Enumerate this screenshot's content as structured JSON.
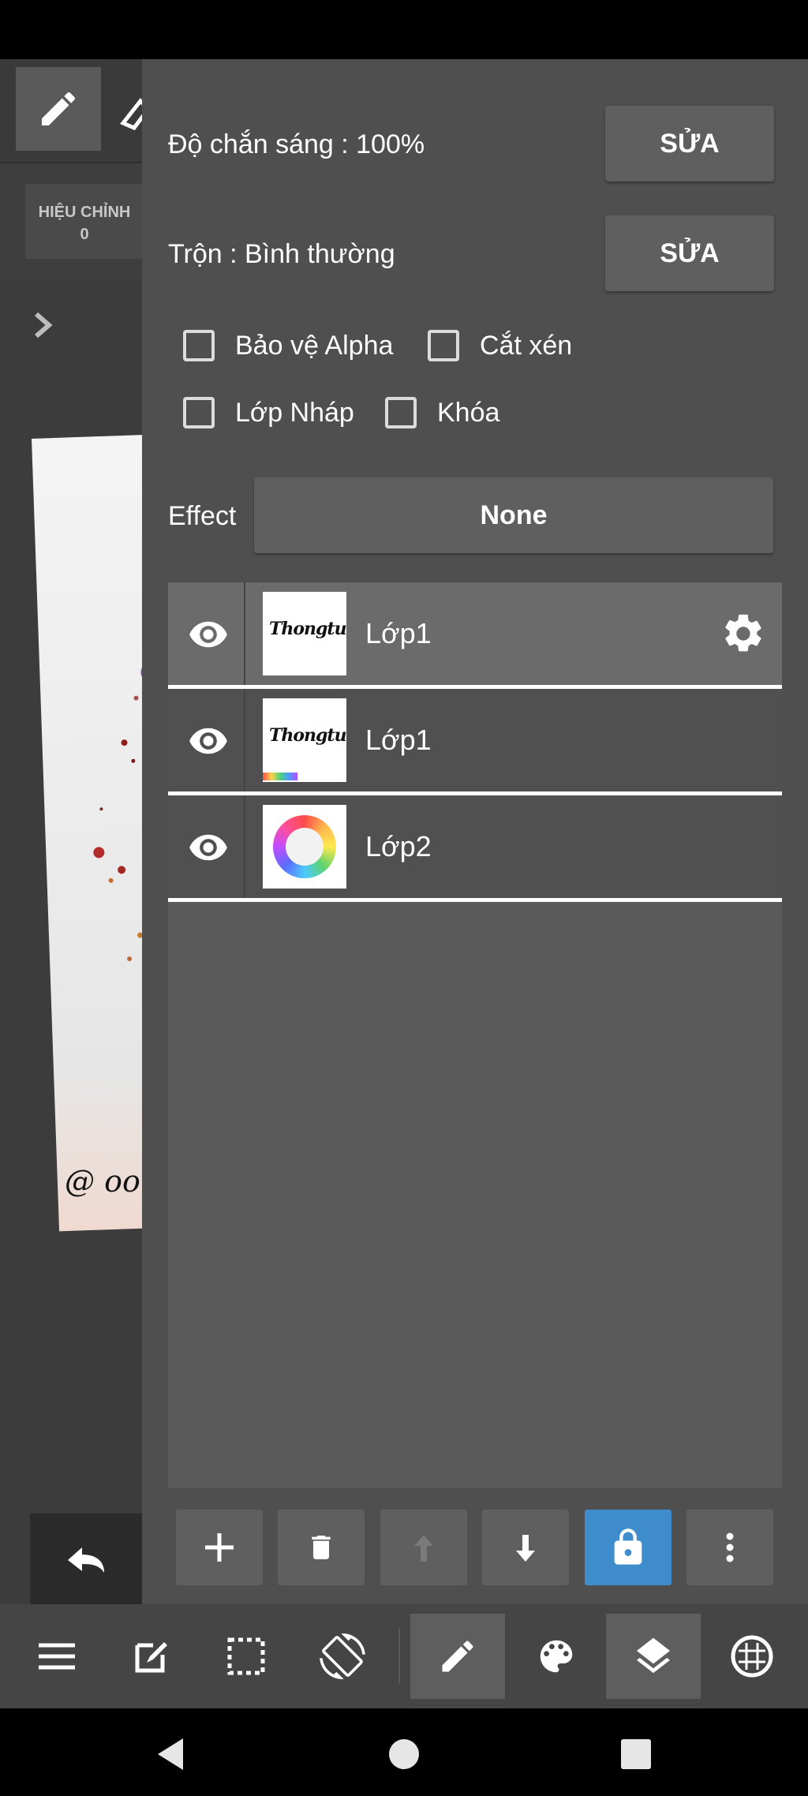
{
  "background": {
    "adjust_label": "HIỆU CHỈNH",
    "adjust_value": "0",
    "canvas_signature": "@ oo"
  },
  "panel": {
    "opacity_label": "Độ chắn sáng : 100%",
    "opacity_edit": "SỬA",
    "blend_label": "Trộn : Bình thường",
    "blend_edit": "SỬA",
    "checkboxes": [
      {
        "label": "Bảo vệ Alpha",
        "checked": false
      },
      {
        "label": "Cắt xén",
        "checked": false
      },
      {
        "label": "Lớp Nháp",
        "checked": false
      },
      {
        "label": "Khóa",
        "checked": false
      }
    ],
    "effect_label": "Effect",
    "effect_value": "None"
  },
  "layers": [
    {
      "name": "Lớp1",
      "thumb_text": "Thongtu",
      "selected": true,
      "visible": true
    },
    {
      "name": "Lớp1",
      "thumb_text": "Thongtu",
      "selected": false,
      "visible": true
    },
    {
      "name": "Lớp2",
      "thumb_text": "",
      "selected": false,
      "visible": true
    }
  ],
  "layer_actions": [
    "add-icon",
    "trash-icon",
    "arrow-up-icon",
    "arrow-down-icon",
    "lock-icon",
    "more-vertical-icon"
  ],
  "toolbar": [
    "menu-icon",
    "edit-icon",
    "selection-icon",
    "rotate-icon",
    "pencil-icon",
    "palette-icon",
    "layers-icon",
    "grid-icon"
  ],
  "colors": {
    "panel": "#4f4f4f",
    "button": "#5f5f5f",
    "accent": "#3f8ccc",
    "selected_layer": "#6b6b6b"
  }
}
